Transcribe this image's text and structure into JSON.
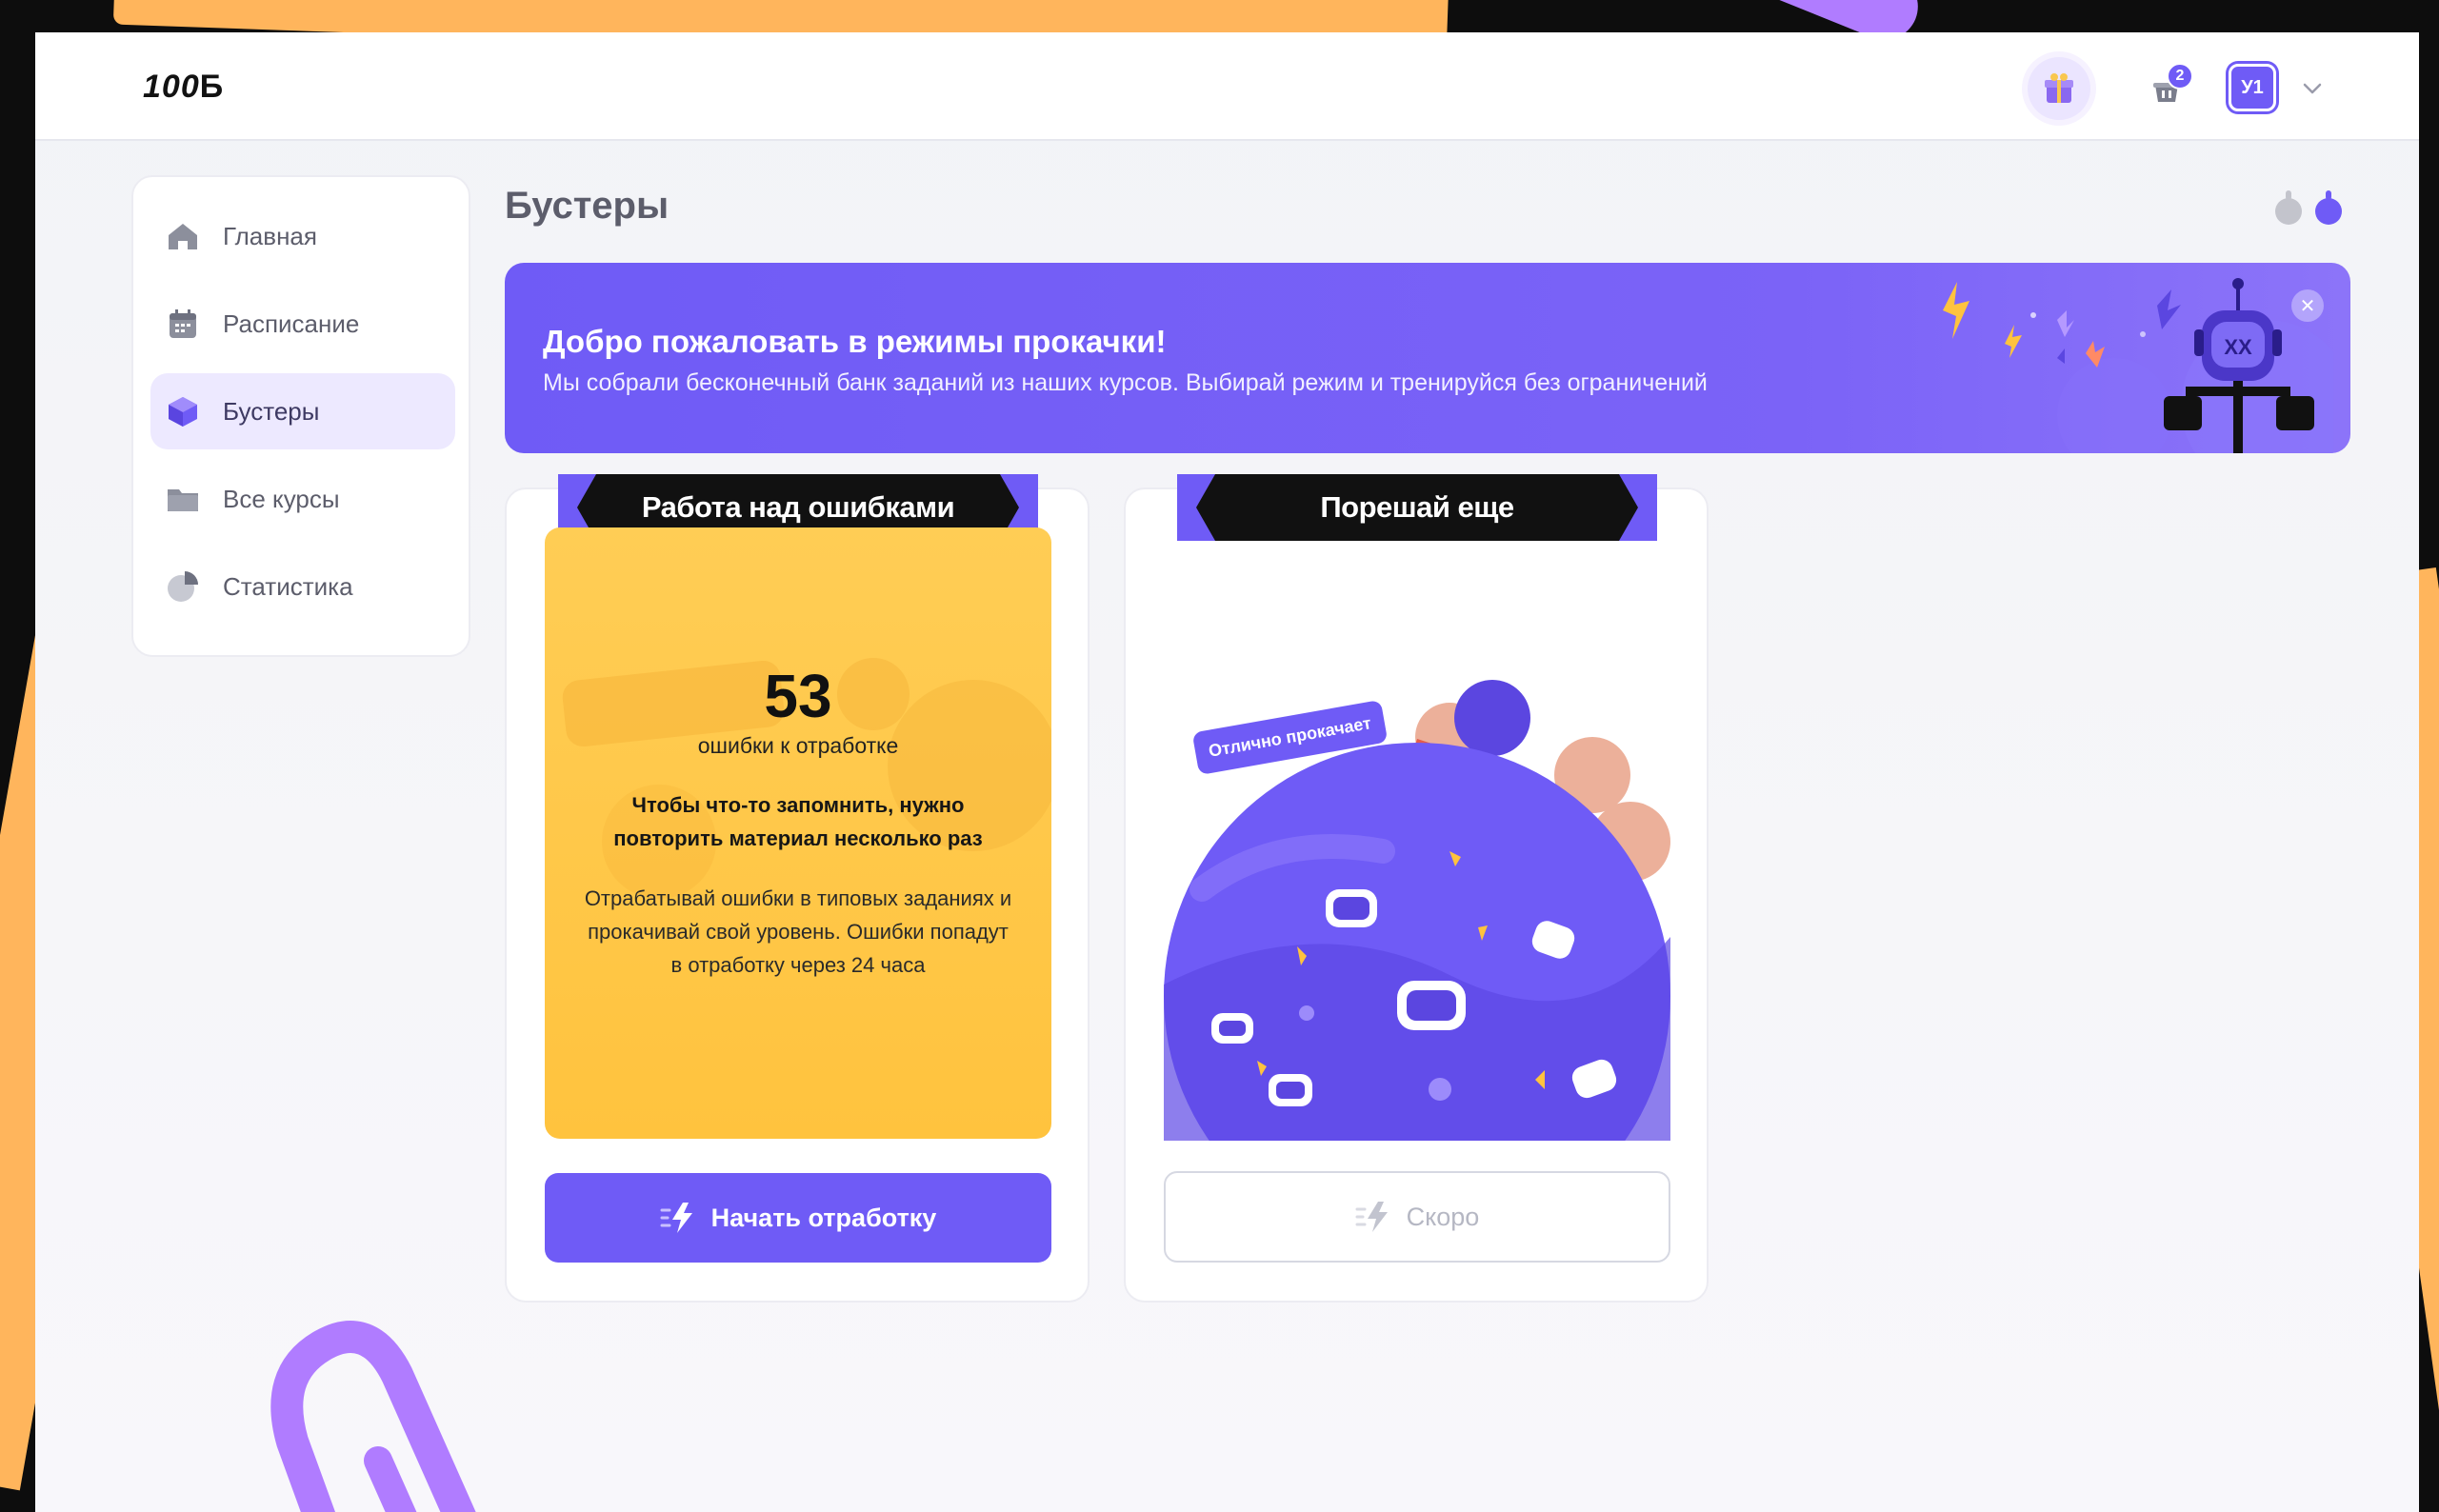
{
  "header": {
    "logo_main": "100",
    "logo_bold": "Б",
    "cart_badge": "2",
    "avatar_initials": "У1"
  },
  "sidebar": {
    "items": [
      {
        "label": "Главная",
        "icon": "home-icon",
        "active": false
      },
      {
        "label": "Расписание",
        "icon": "calendar-icon",
        "active": false
      },
      {
        "label": "Бустеры",
        "icon": "cube-icon",
        "active": true
      },
      {
        "label": "Все курсы",
        "icon": "folder-icon",
        "active": false
      },
      {
        "label": "Статистика",
        "icon": "pie-chart-icon",
        "active": false
      }
    ]
  },
  "main": {
    "title": "Бустеры",
    "banner": {
      "title": "Добро пожаловать в режимы прокачки!",
      "text": "Мы собрали бесконечный банк заданий из наших курсов. Выбирай режим и тренируйся без ограничений"
    },
    "cards": [
      {
        "ribbon": "Работа над ошибками",
        "count": "53",
        "count_label": "ошибки к отработке",
        "tip_bold": "Чтобы что-то запомнить, нужно повторить материал несколько раз",
        "tip_text": "Отрабатывай ошибки в типовых заданиях и прокачивай свой уровень. Ошибки попадут в отработку через 24 часа",
        "button": "Начать отработку"
      },
      {
        "ribbon": "Порешай еще",
        "tag": "Отлично прокачает",
        "button": "Скоро"
      }
    ]
  },
  "colors": {
    "accent": "#6f5bf6",
    "yellow": "#ffc33e",
    "ribbon": "#111111",
    "background": "#f4f5f8"
  }
}
